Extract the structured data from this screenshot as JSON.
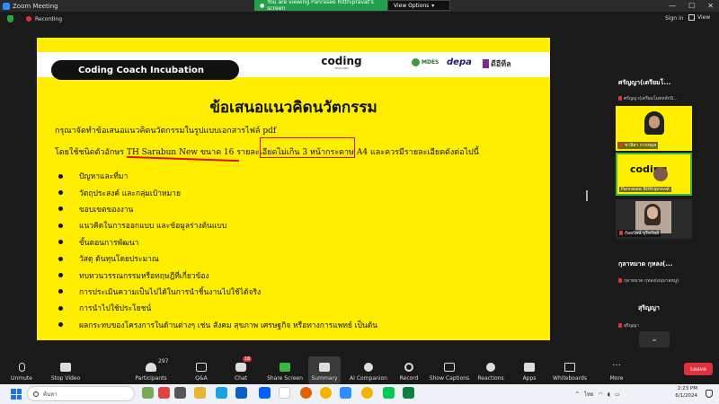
{
  "window": {
    "title": "Zoom Meeting",
    "share_message": "You are viewing Panrasee Ritthipravat's screen",
    "view_options": "View Options",
    "controls": [
      "—",
      "☐",
      "✕"
    ]
  },
  "status": {
    "recording": "Recording",
    "sign_in": "Sign in",
    "view": "View"
  },
  "slide": {
    "header_pill": "Coding Coach Incubation",
    "logo_coding": "coding",
    "logo_coding_sub": "THAILAND",
    "logo_mdes": "MDES",
    "logo_depa": "depa",
    "logo_dsth": "ดีอีทีล",
    "title": "ข้อเสนอแนวคิดนวัตกรรม",
    "line1": "กรุณาจัดทำข้อเสนอแนวคิดนวัตกรรมในรูปแบบเอกสารไฟล์ pdf",
    "line2": "โดยใช้ชนิดตัวอักษร TH Sarabun New ขนาด 16 รายละเอียดไม่เกิน 3 หน้ากระดาษ A4 และควรมีรายละเอียดดังต่อไปนี้",
    "bullets": [
      "ปัญหาและที่มา",
      "วัตถุประสงค์ และกลุ่มเป้าหมาย",
      "ขอบเขตของงาน",
      "แนวคิดในการออกแบบ และข้อมูลร่างต้นแบบ",
      "ขั้นตอนการพัฒนา",
      "วัสดุ ต้นทุนโดยประมาณ",
      "ทบทวนวรรณกรรมหรือทฤษฎีที่เกี่ยวข้อง",
      "การประเมินความเป็นไปได้ในการนำชิ้นงานไปใช้ได้จริง",
      "การนำไปใช้ประโยชน์",
      "ผลกระทบของโครงการในด้านต่างๆ เช่น สังคม สุขภาพ เศรษฐกิจ หรือทางการแพทย์ เป็นต้น"
    ]
  },
  "participants": {
    "top_name": "ศรัญญา(เตรียมโ...",
    "top_sub": "ศรัญญา(เตรียมโมทหลักนิ...",
    "tile1_label": "ชาลิสา กากหมุล",
    "tile2_label": "Panrasee Ritthipravat",
    "tile2_logo": "coding",
    "tile3_label": "กัลยรัตน์ บุรีทรัพย์",
    "mid_name": "กุลาหมาด กุหลง(...",
    "mid_sub": "กุลาหมาด กุหลง(อนุบาลหนู)",
    "bot_name": "สุริญญา",
    "bot_sub": "สุริญญา",
    "scroll_down": "⌄"
  },
  "toolbar": {
    "unmute": "Unmute",
    "stop_video": "Stop Video",
    "participants": "Participants",
    "participants_count": "297",
    "qa": "Q&A",
    "chat": "Chat",
    "chat_badge": "18",
    "share_screen": "Share Screen",
    "summary": "Summary",
    "ai_companion": "AI Companion",
    "record": "Record",
    "show_captions": "Show Captions",
    "reactions": "Reactions",
    "apps": "Apps",
    "whiteboards": "Whiteboards",
    "more": "More",
    "leave": "Leave"
  },
  "taskbar": {
    "search": "ค้นหา",
    "lang": "ไทย",
    "time": "2:23 PM",
    "date": "6/1/2024"
  },
  "colors": {
    "slide_bg": "#ffee00",
    "share_green": "#22a04c",
    "leave_red": "#e0323c"
  }
}
